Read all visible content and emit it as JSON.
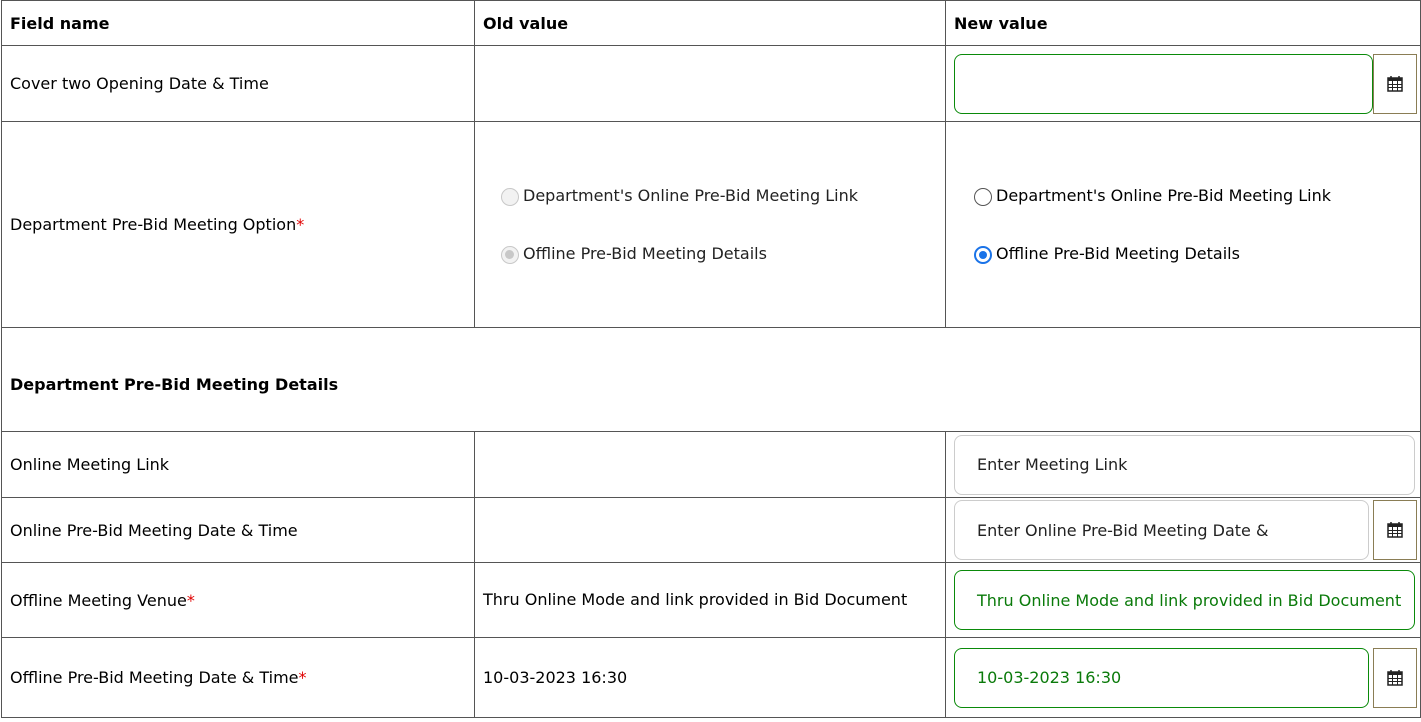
{
  "headers": {
    "field": "Field name",
    "old": "Old value",
    "new": "New value"
  },
  "rows": {
    "cover_two": {
      "label": "Cover two Opening Date & Time",
      "old": "",
      "new": ""
    },
    "prebid_option": {
      "label": "Department Pre-Bid Meeting Option",
      "required": "*",
      "opt_online": "Department's Online Pre-Bid Meeting Link",
      "opt_offline": "Offline Pre-Bid Meeting Details"
    },
    "section_title": "Department Pre-Bid Meeting Details",
    "online_link": {
      "label": "Online Meeting Link",
      "old": "",
      "placeholder": "Enter Meeting Link"
    },
    "online_datetime": {
      "label": "Online Pre-Bid Meeting Date & Time",
      "old": "",
      "placeholder": "Enter Online Pre-Bid Meeting Date &"
    },
    "offline_venue": {
      "label": "Offline Meeting Venue",
      "required": "*",
      "old": "Thru Online Mode and link provided in Bid Document",
      "new": "Thru Online Mode and link provided in Bid Document"
    },
    "offline_datetime": {
      "label": "Offline Pre-Bid Meeting Date & Time",
      "required": "*",
      "old": "10-03-2023 16:30",
      "new": "10-03-2023 16:30"
    }
  },
  "icons": {
    "calendar": "calendar-icon"
  },
  "colors": {
    "valid_border": "#0a8a0a",
    "required": "#e00000",
    "radio_checked": "#1a73e8"
  }
}
